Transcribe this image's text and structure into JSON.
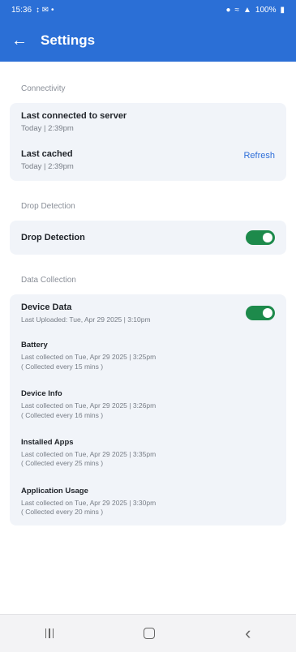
{
  "status_bar": {
    "time": "15:36",
    "left_icons": "↕ ✉ •",
    "battery_text": "100%"
  },
  "app_bar": {
    "back_icon": "arrow-left-icon",
    "title": "Settings"
  },
  "sections": {
    "connectivity": {
      "title": "Connectivity",
      "last_connected_label": "Last connected to server",
      "last_connected_value": "Today | 2:39pm",
      "last_cached_label": "Last cached",
      "last_cached_value": "Today | 2:39pm",
      "refresh_label": "Refresh"
    },
    "drop_detection": {
      "title": "Drop Detection",
      "item_label": "Drop Detection",
      "enabled": true
    },
    "data_collection": {
      "title": "Data Collection",
      "device_data_label": "Device Data",
      "device_data_sub": "Last Uploaded: Tue, Apr 29 2025 | 3:10pm",
      "device_data_enabled": true,
      "items": [
        {
          "label": "Battery",
          "line1": "Last collected on Tue, Apr 29 2025 | 3:25pm",
          "line2": "( Collected every 15 mins )"
        },
        {
          "label": "Device Info",
          "line1": "Last collected on Tue, Apr 29 2025 | 3:26pm",
          "line2": "( Collected every 16 mins )"
        },
        {
          "label": "Installed Apps",
          "line1": "Last collected on Tue, Apr 29 2025 | 3:35pm",
          "line2": "( Collected every 25 mins )"
        },
        {
          "label": "Application Usage",
          "line1": "Last collected on Tue, Apr 29 2025 | 3:30pm",
          "line2": "( Collected every 20 mins )"
        }
      ]
    }
  },
  "nav_bar": {
    "recents_icon": "recents-icon",
    "home_icon": "home-icon",
    "back_icon": "back-chevron-icon",
    "back_glyph": "‹"
  },
  "colors": {
    "primary": "#2b6fd6",
    "toggle_on": "#1d8a4b",
    "card_bg": "#f1f4f9",
    "link": "#2f6fd9"
  }
}
